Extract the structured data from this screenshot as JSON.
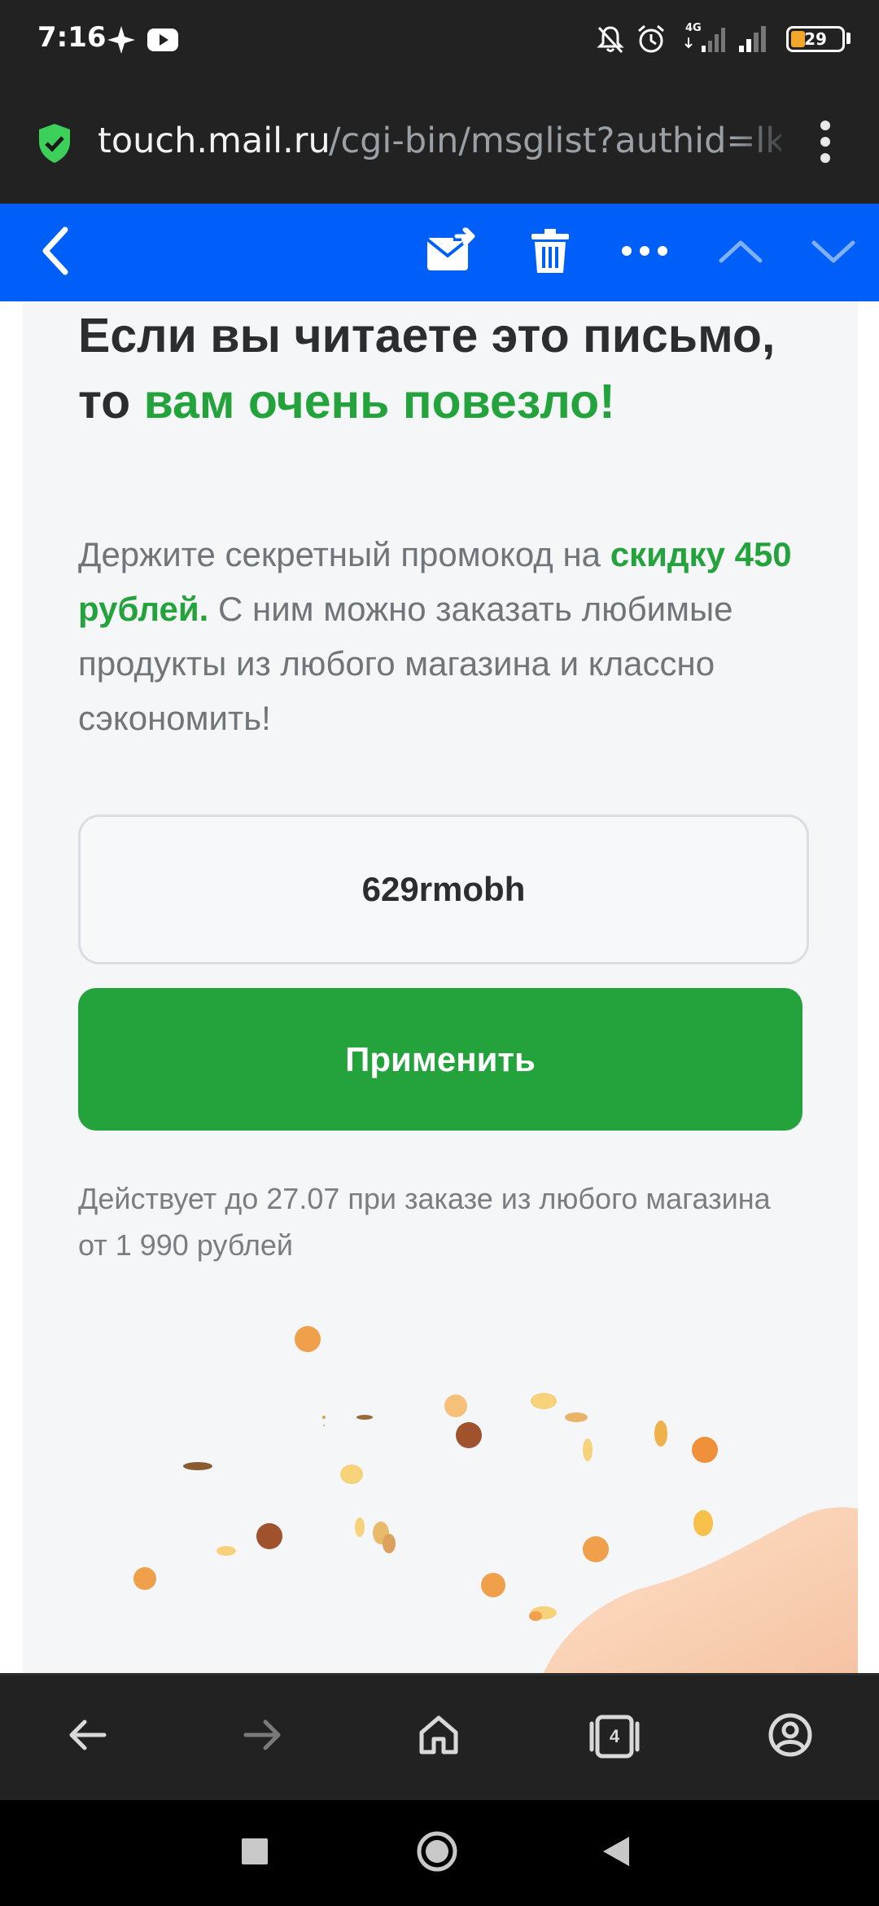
{
  "status_bar": {
    "time": "7:16",
    "network": "4G",
    "battery": "29",
    "battery_level": 0.29
  },
  "browser": {
    "url_host": "touch.mail.ru",
    "url_path": "/cgi-bin/msglist?authid=lk"
  },
  "email": {
    "headline_part1": "Если вы читаете это письмо, то ",
    "headline_highlight": "вам очень повезло!",
    "para_part1": "Держите секретный промокод на ",
    "para_highlight": "скидку 450 рублей.",
    "para_part2": " С ним можно заказать любимые продукты из любого магазина и классно сэкономить!",
    "promo_code": "629rmobh",
    "apply_label": "Применить",
    "terms": "Действует до 27.07 при заказе из любого магазина от 1 990 рублей"
  },
  "bottom_nav": {
    "tabs_count": "4"
  },
  "colors": {
    "toolbar": "#005ff9",
    "accent_green": "#24a33c",
    "dark_bar": "#222222"
  },
  "icons": [
    "back-chevron-icon",
    "move-to-folder-icon",
    "trash-icon",
    "more-icon",
    "chevron-up-icon",
    "chevron-down-icon",
    "shield-check-icon",
    "kebab-menu-icon",
    "back-arrow-icon",
    "forward-arrow-icon",
    "home-icon",
    "tabs-icon",
    "account-icon"
  ]
}
